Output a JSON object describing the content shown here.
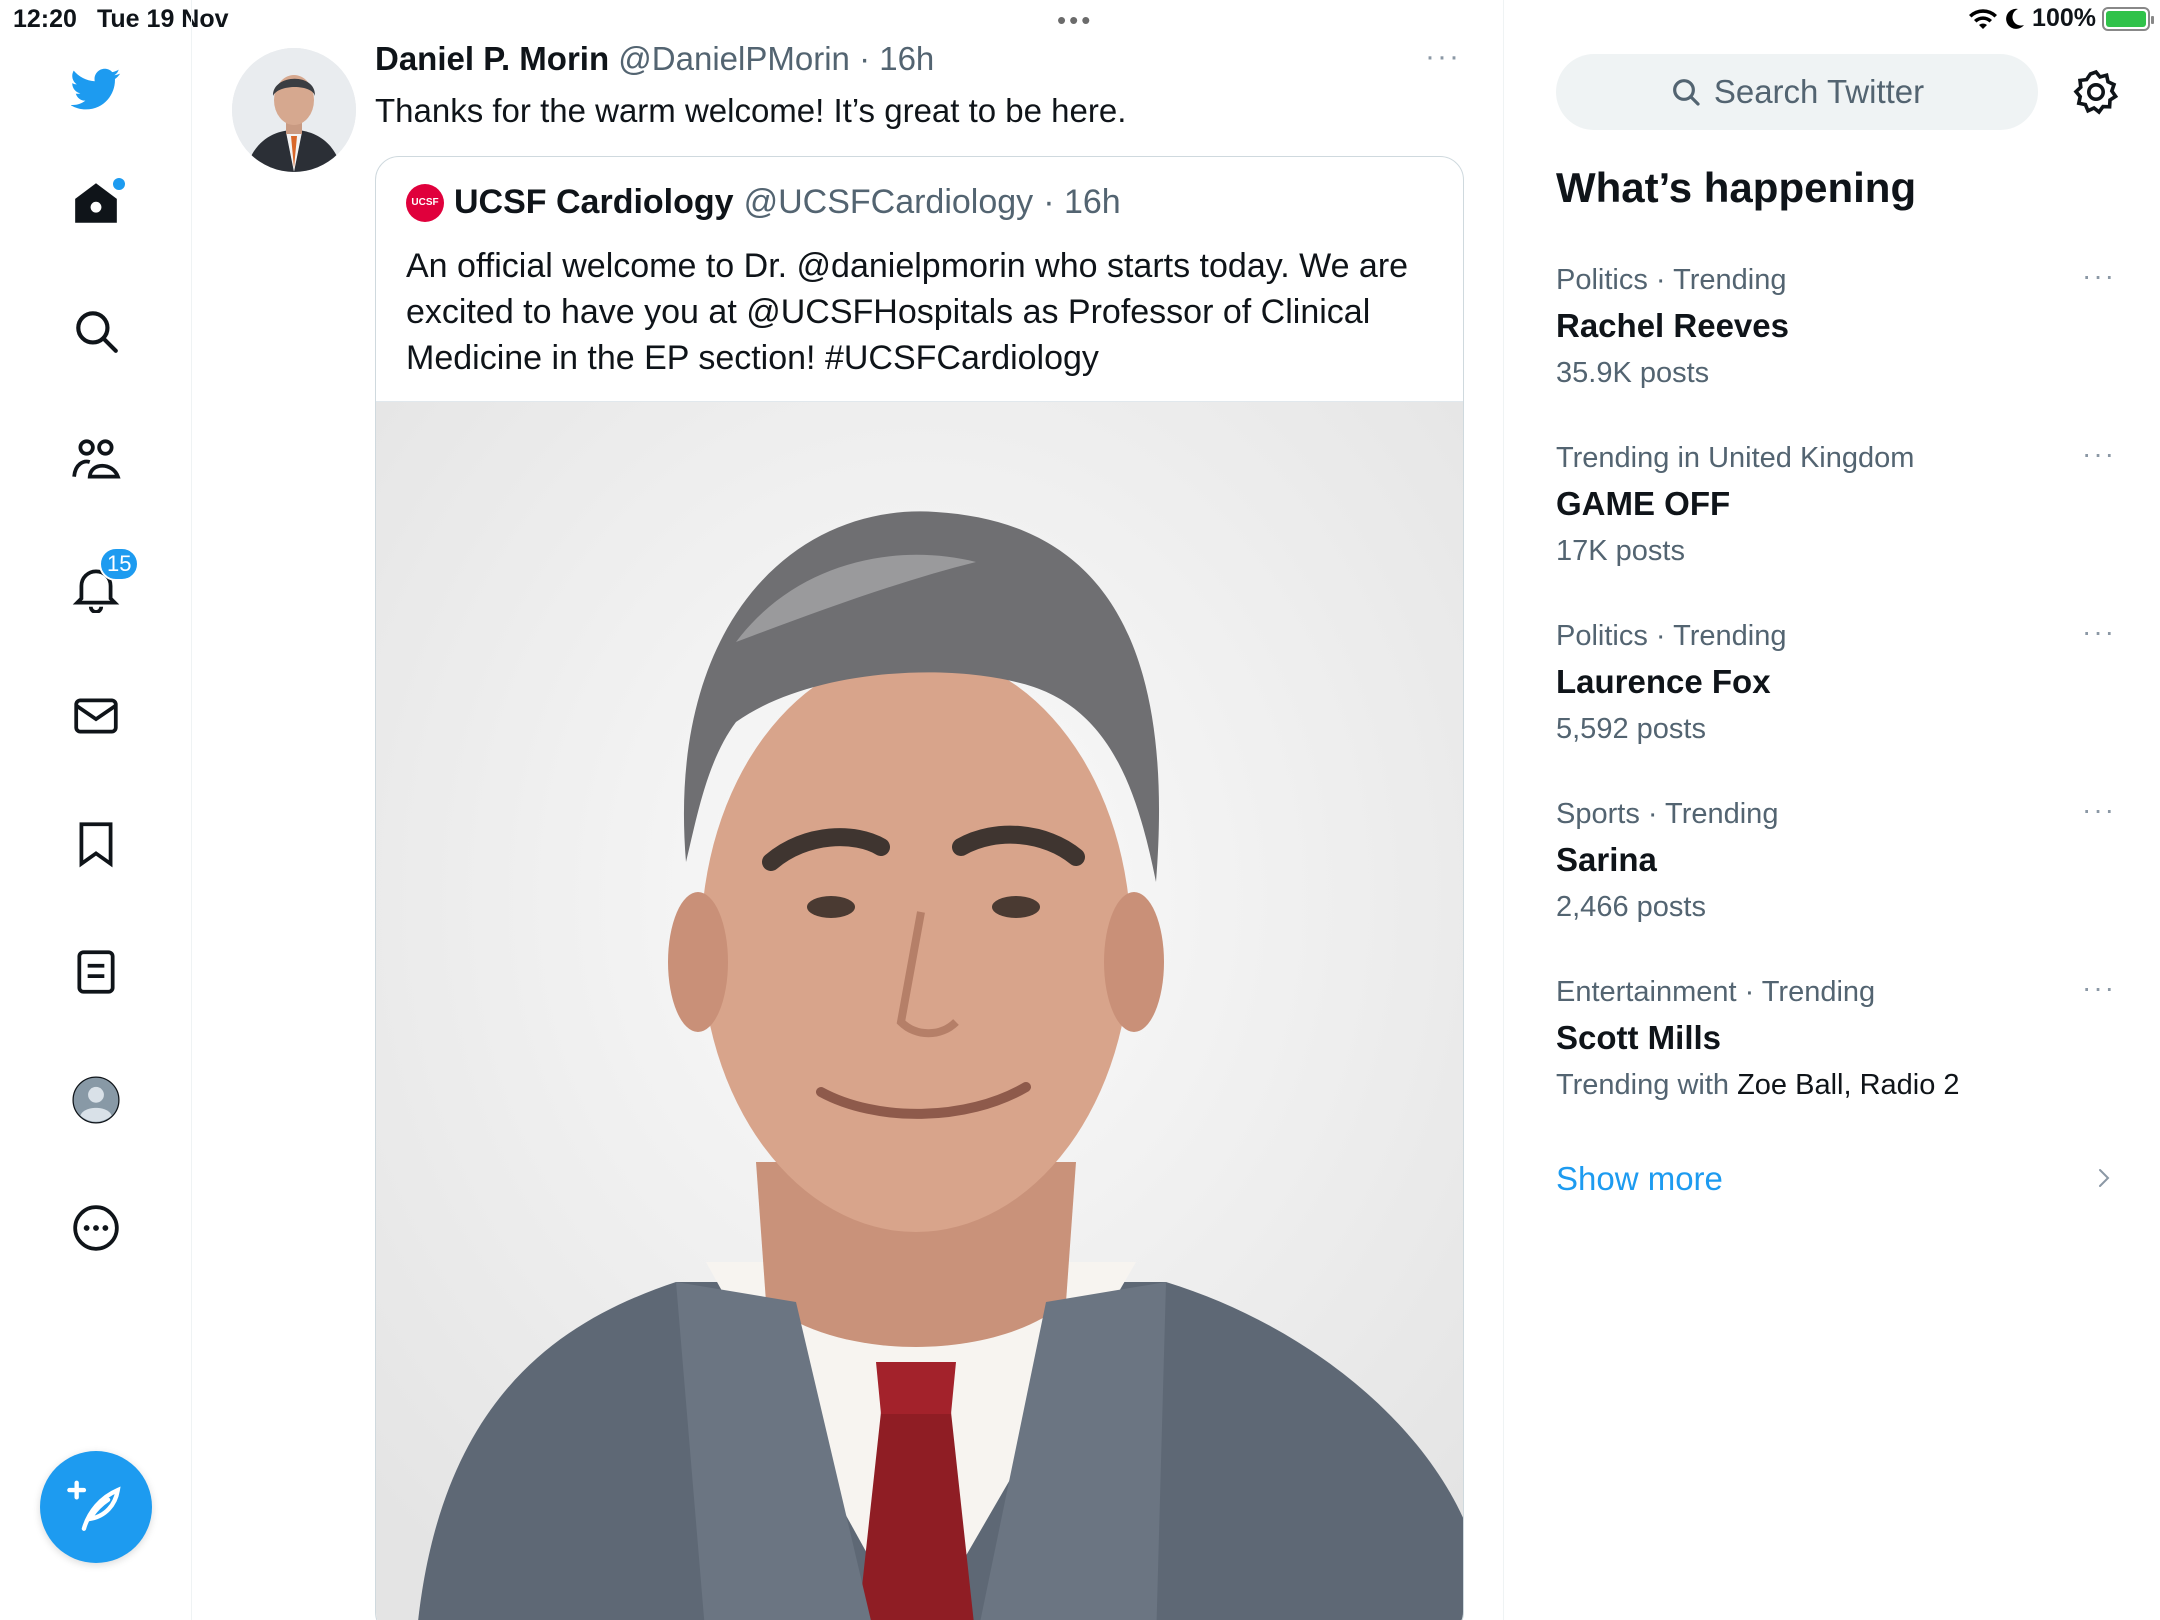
{
  "status_bar": {
    "time": "12:20",
    "date": "Tue 19 Nov",
    "battery": "100%",
    "icons": [
      "wifi-icon",
      "moon-icon",
      "battery-charging-icon"
    ]
  },
  "nav": {
    "notifications_badge": "15",
    "items": [
      "twitter-logo-icon",
      "home-icon",
      "search-icon",
      "communities-icon",
      "bell-icon",
      "mail-icon",
      "bookmark-icon",
      "list-icon",
      "profile-icon",
      "more-icon"
    ]
  },
  "tweet": {
    "name": "Daniel P. Morin",
    "handle": "@DanielPMorin",
    "time": "· 16h",
    "text": "Thanks for the warm welcome! It’s great to be here.",
    "more": "···"
  },
  "quote": {
    "logo_text": "UCSF",
    "name": "UCSF Cardiology",
    "handle": "@UCSFCardiology",
    "time": "· 16h",
    "text": "An official welcome to Dr. @danielpmorin who starts today. We are excited to have you at @UCSFHospitals as Professor of Clinical Medicine in the EP section! #UCSFCardiology"
  },
  "sidebar": {
    "search_placeholder": "Search Twitter",
    "heading": "What’s happening",
    "trends": [
      {
        "meta": "Politics · Trending",
        "title": "Rachel Reeves",
        "count": "35.9K posts"
      },
      {
        "meta": "Trending in United Kingdom",
        "title": "GAME OFF",
        "count": "17K posts"
      },
      {
        "meta": "Politics · Trending",
        "title": "Laurence Fox",
        "count": "5,592 posts"
      },
      {
        "meta": "Sports · Trending",
        "title": "Sarina",
        "count": "2,466 posts"
      },
      {
        "meta": "Entertainment · Trending",
        "title": "Scott Mills",
        "count_prefix": "Trending with ",
        "count_highlight": "Zoe Ball, Radio 2"
      }
    ],
    "show_more": "Show more"
  },
  "colors": {
    "accent": "#1d9bf0",
    "ucsf_red": "#e0003c"
  }
}
